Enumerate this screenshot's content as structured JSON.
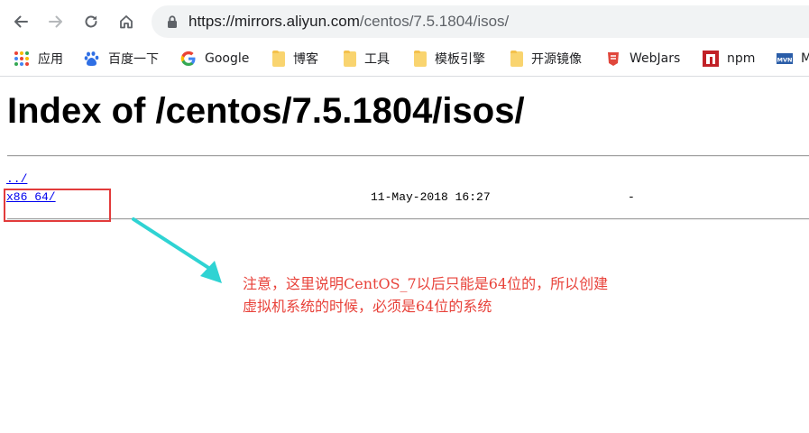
{
  "browser": {
    "url_host": "https://mirrors.aliyun.com",
    "url_path": "/centos/7.5.1804/isos/"
  },
  "bookmarks": [
    {
      "label": "应用",
      "icon": "apps-grid-icon"
    },
    {
      "label": "百度一下",
      "icon": "baidu-paw-icon"
    },
    {
      "label": "Google",
      "icon": "google-g-icon"
    },
    {
      "label": "博客",
      "icon": "folder-icon"
    },
    {
      "label": "工具",
      "icon": "folder-icon"
    },
    {
      "label": "模板引擎",
      "icon": "folder-icon"
    },
    {
      "label": "开源镜像",
      "icon": "folder-icon"
    },
    {
      "label": "WebJars",
      "icon": "webjars-icon"
    },
    {
      "label": "npm",
      "icon": "npm-icon"
    },
    {
      "label": "M",
      "icon": "mvn-icon"
    }
  ],
  "page": {
    "title": "Index of /centos/7.5.1804/isos/",
    "parent_link": "../",
    "entries": [
      {
        "name": "x86_64/",
        "date": "11-May-2018 16:27",
        "size": "-"
      }
    ]
  },
  "annotation": {
    "line1": "注意，这里说明CentOS_7以后只能是64位的，所以创建",
    "line2": "虚拟机系统的时候，必须是64位的系统",
    "color": "#e8423a",
    "arrow_color": "#2fd3d3"
  }
}
